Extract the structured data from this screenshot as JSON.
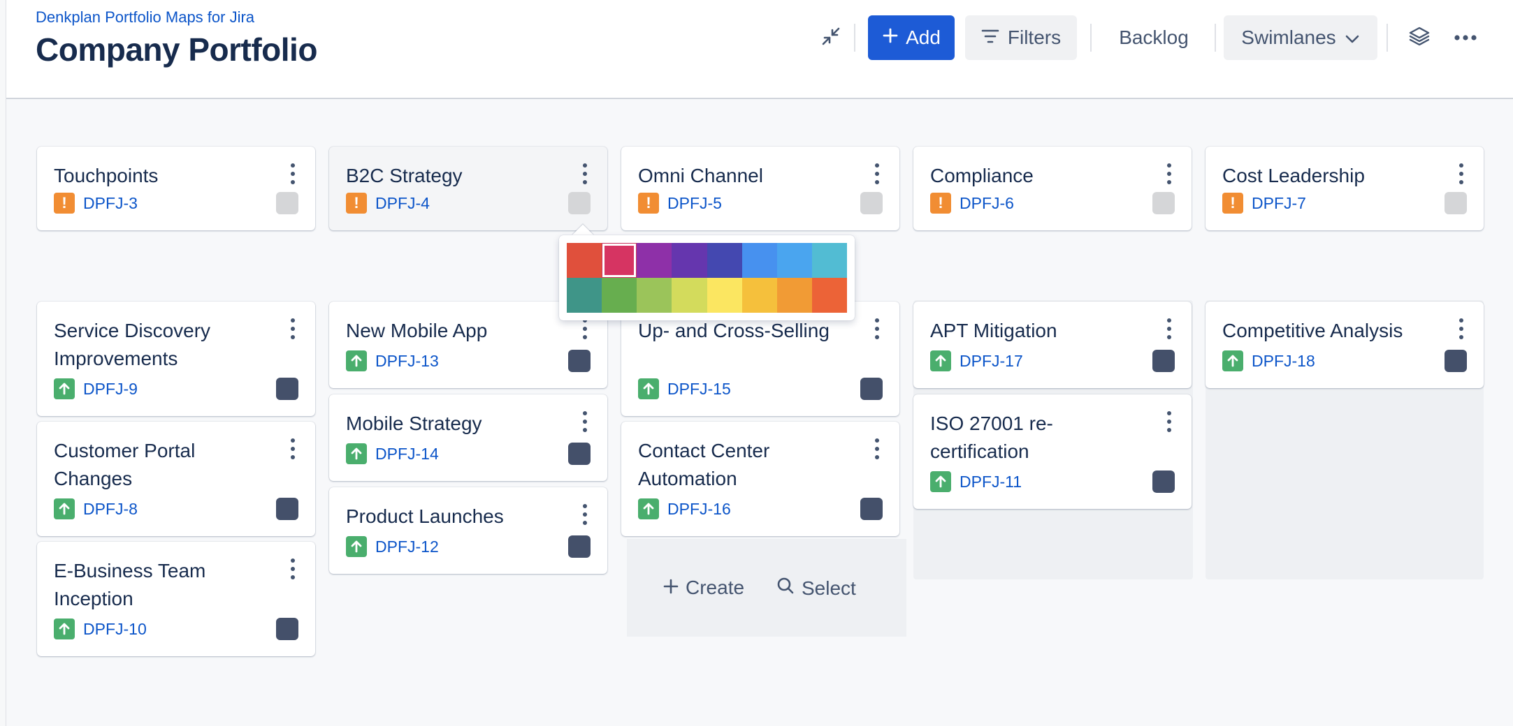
{
  "header": {
    "app_name": "Denkplan Portfolio Maps for Jira",
    "title": "Company Portfolio",
    "add_label": "Add",
    "filters_label": "Filters",
    "backlog_label": "Backlog",
    "swimlanes_label": "Swimlanes"
  },
  "colors": {
    "brand": "#1D5BD6",
    "link": "#0C55C9",
    "priority_icon": "#F18D33",
    "improvement_icon": "#4AAE6D",
    "chip_default": "#D5D6D8",
    "chip_dark": "#44506A"
  },
  "epics": [
    {
      "title": "Touchpoints",
      "key": "DPFJ-3"
    },
    {
      "title": "B2C Strategy",
      "key": "DPFJ-4"
    },
    {
      "title": "Omni Channel",
      "key": "DPFJ-5"
    },
    {
      "title": "Compliance",
      "key": "DPFJ-6"
    },
    {
      "title": "Cost Leadership",
      "key": "DPFJ-7"
    }
  ],
  "cards": {
    "col1": [
      {
        "title": "Service Discovery Improvements",
        "key": "DPFJ-9"
      },
      {
        "title": "Customer Portal Changes",
        "key": "DPFJ-8"
      },
      {
        "title": "E-Business Team Inception",
        "key": "DPFJ-10"
      }
    ],
    "col2": [
      {
        "title": "New Mobile App",
        "key": "DPFJ-13"
      },
      {
        "title": "Mobile Strategy",
        "key": "DPFJ-14"
      },
      {
        "title": "Product Launches",
        "key": "DPFJ-12"
      }
    ],
    "col3": [
      {
        "title": "Up- and Cross-Selling",
        "key": "DPFJ-15"
      },
      {
        "title": "Contact Center Automation",
        "key": "DPFJ-16"
      }
    ],
    "col4": [
      {
        "title": "APT Mitigation",
        "key": "DPFJ-17"
      },
      {
        "title": "ISO 27001 re-certification",
        "key": "DPFJ-11"
      }
    ],
    "col5": [
      {
        "title": "Competitive Analysis",
        "key": "DPFJ-18"
      }
    ]
  },
  "column_actions": {
    "create_label": "Create",
    "select_label": "Select"
  },
  "color_picker": {
    "selected_index": 1,
    "swatches": [
      "#E0503C",
      "#D63462",
      "#8E30A8",
      "#6536AE",
      "#4448B0",
      "#4791EF",
      "#4AA5EF",
      "#52BCD3",
      "#3F9588",
      "#67AE4F",
      "#9BC45A",
      "#D3DB5C",
      "#FBE661",
      "#F5C03C",
      "#F19B35",
      "#EC6337"
    ]
  }
}
